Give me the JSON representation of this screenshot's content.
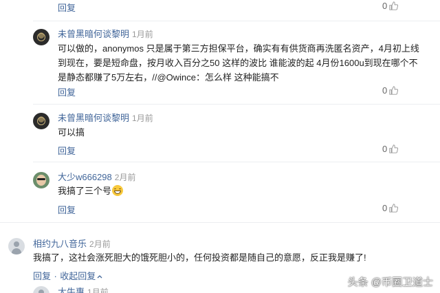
{
  "comments": [
    {
      "reply_label": "回复",
      "likes": "0"
    },
    {
      "user": "未曾黑暗何谈黎明",
      "time": "1月前",
      "lines": [
        "可以做的，anonymos 只是属于第三方担保平台，确实有有供货商再洗匿名资产，4月初上线",
        "到现在，要是短命盘，按月收入百分之50 这样的波比 谁能波的起 4月份1600u到现在哪个不",
        "是静态都赚了5万左右，//@Owince：怎么样 这种能搞不"
      ],
      "reply_label": "回复",
      "likes": "0"
    },
    {
      "user": "未曾黑暗何谈黎明",
      "time": "1月前",
      "lines": [
        "可以搞"
      ],
      "reply_label": "回复",
      "likes": "0"
    },
    {
      "user": "大少w666298",
      "time": "2月前",
      "lines": [
        "我搞了三个号"
      ],
      "reply_label": "回复",
      "likes": "0"
    },
    {
      "user": "相约九八音乐",
      "time": "2月前",
      "lines": [
        "我搞了，这社会涨死胆大的饿死胆小的，任何投资都是随自己的意愿，反正我是赚了!"
      ],
      "reply_label": "回复",
      "collapse_label": "收起回复",
      "separator": "·"
    },
    {
      "user": "大牛惠",
      "time": "1月前"
    }
  ],
  "icons": {
    "like": "thumbs-up-icon",
    "collapse": "chevron-up-icon",
    "emoji": "grinning-emoji-icon"
  },
  "watermark": "头条 @币圈卫道士",
  "colors": {
    "link": "#406599",
    "time": "#999999",
    "text": "#222222",
    "divider": "#eceef1"
  }
}
